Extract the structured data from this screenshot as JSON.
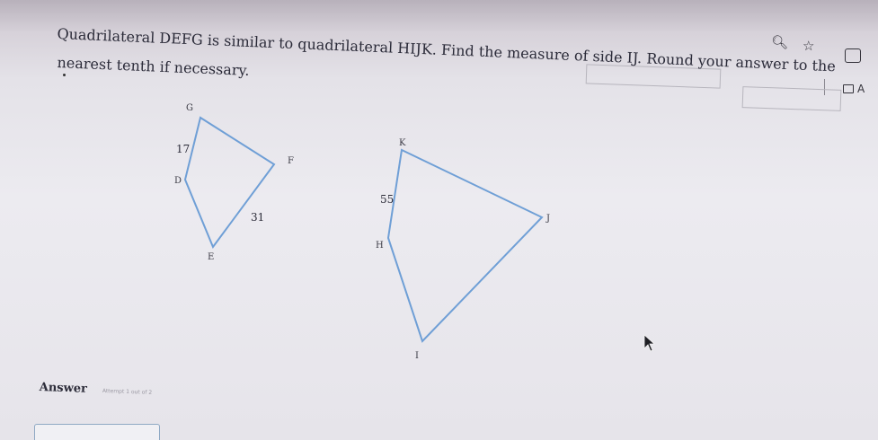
{
  "question": {
    "line1": "Quadrilateral DEFG is similar to quadrilateral HIJK. Find the measure of side IJ. Round your answer to the",
    "line2": "nearest tenth if necessary."
  },
  "figure_defg": {
    "vertices": {
      "G": "G",
      "D": "D",
      "E": "E",
      "F": "F"
    },
    "side_dg": "17",
    "side_ef": "31"
  },
  "figure_hijk": {
    "vertices": {
      "K": "K",
      "H": "H",
      "I": "I",
      "J": "J"
    },
    "side_hk": "55"
  },
  "answer": {
    "label": "Answer",
    "attempt": "Attempt 1 out of 2"
  },
  "side_panel": {
    "label": "A"
  },
  "icons": [
    "zoom-icon",
    "star-icon",
    "extension-icon",
    "folder-icon",
    "cursor-icon"
  ]
}
